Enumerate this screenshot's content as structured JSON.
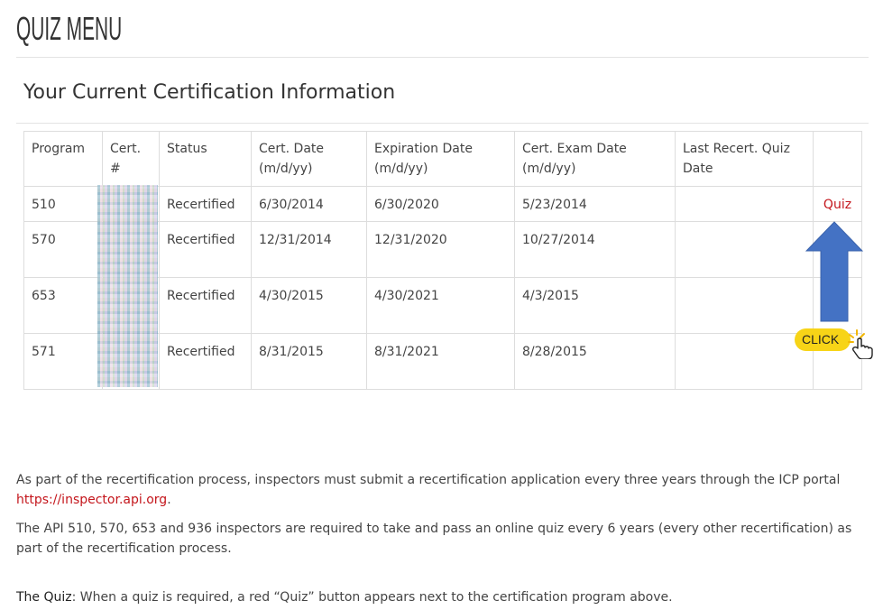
{
  "header": {
    "title": "QUIZ MENU"
  },
  "section": {
    "title": "Your Current Certification Information"
  },
  "table": {
    "headers": {
      "program": "Program",
      "cert_line1": "Cert.",
      "cert_line2": "#",
      "status": "Status",
      "cert_date_line1": "Cert. Date",
      "cert_date_line2": "(m/d/yy)",
      "exp_date_line1": "Expiration Date",
      "exp_date_line2": "(m/d/yy)",
      "exam_date_line1": "Cert. Exam Date",
      "exam_date_line2": "(m/d/yy)",
      "last_quiz_line1": "Last Recert. Quiz",
      "last_quiz_line2": "Date"
    },
    "rows": [
      {
        "program": "510",
        "status": "Recertified",
        "cert_date": "6/30/2014",
        "exp_date": "6/30/2020",
        "exam_date": "5/23/2014",
        "last_quiz": "",
        "action": "Quiz"
      },
      {
        "program": "570",
        "status": "Recertified",
        "cert_date": "12/31/2014",
        "exp_date": "12/31/2020",
        "exam_date": "10/27/2014",
        "last_quiz": "",
        "action": ""
      },
      {
        "program": "653",
        "status": "Recertified",
        "cert_date": "4/30/2015",
        "exp_date": "4/30/2021",
        "exam_date": "4/3/2015",
        "last_quiz": "",
        "action": ""
      },
      {
        "program": "571",
        "status": "Recertified",
        "cert_date": "8/31/2015",
        "exp_date": "8/31/2021",
        "exam_date": "8/28/2015",
        "last_quiz": "",
        "action": ""
      }
    ]
  },
  "callout": {
    "click_label": "CLICK",
    "arrow_color": "#4472c4",
    "badge_color": "#f7d417"
  },
  "info": {
    "p1_text": "As part of the recertification process, inspectors must submit a recertification application every three years through the ICP portal ",
    "p1_link": "https://inspector.api.org",
    "p1_end": ".",
    "p2": "The API 510, 570, 653 and 936 inspectors are required to take and pass an online quiz every 6 years (every other recertification) as part of the recertification process.",
    "p3_label": "The Quiz",
    "p3_text": ": When a quiz is required, a red “Quiz” button appears next to the certification program above."
  },
  "colors": {
    "accent_red": "#c4161c",
    "text": "#444444",
    "border": "#dddddd"
  }
}
